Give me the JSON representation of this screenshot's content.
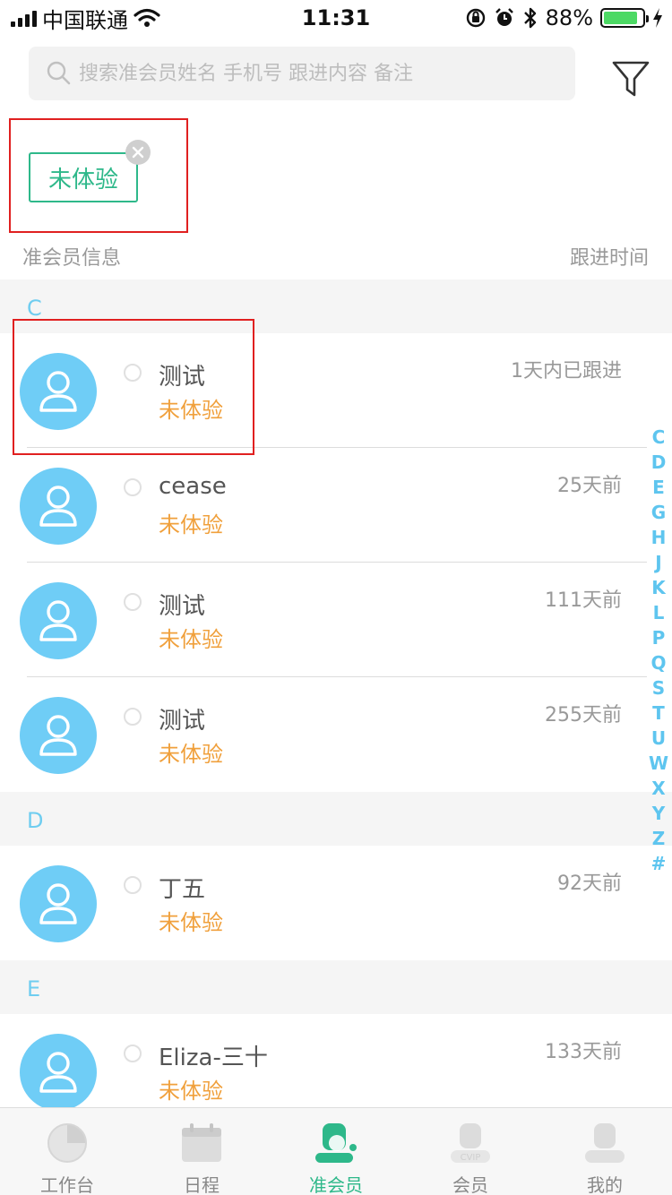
{
  "status_bar": {
    "carrier": "中国联通",
    "time": "11:31",
    "battery_percent": "88%",
    "battery_level": 0.88
  },
  "search": {
    "placeholder": "搜索准会员姓名 手机号 跟进内容 备注"
  },
  "filter_tag": {
    "label": "未体验"
  },
  "list_header": {
    "left": "准会员信息",
    "right": "跟进时间"
  },
  "sections": [
    {
      "letter": "C",
      "rows": [
        {
          "name": "测试",
          "status": "未体验",
          "time": "1天内已跟进"
        },
        {
          "name": "cease",
          "status": "未体验",
          "time": "25天前"
        },
        {
          "name": "测试",
          "status": "未体验",
          "time": "111天前"
        },
        {
          "name": "测试",
          "status": "未体验",
          "time": "255天前"
        }
      ]
    },
    {
      "letter": "D",
      "rows": [
        {
          "name": "丁五",
          "status": "未体验",
          "time": "92天前"
        }
      ]
    },
    {
      "letter": "E",
      "rows": [
        {
          "name": "Eliza-三十",
          "status": "未体验",
          "time": "133天前"
        }
      ]
    }
  ],
  "index_letters": [
    "C",
    "D",
    "E",
    "G",
    "H",
    "J",
    "K",
    "L",
    "P",
    "Q",
    "S",
    "T",
    "U",
    "W",
    "X",
    "Y",
    "Z",
    "#"
  ],
  "tabs": [
    {
      "label": "工作台",
      "icon": "pie-chart-icon"
    },
    {
      "label": "日程",
      "icon": "calendar-icon"
    },
    {
      "label": "准会员",
      "icon": "prospect-member-icon",
      "active": true
    },
    {
      "label": "会员",
      "icon": "vip-member-icon"
    },
    {
      "label": "我的",
      "icon": "person-icon"
    }
  ],
  "colors": {
    "accent": "#2eb88a",
    "status": "#f0a03c",
    "avatar": "#6fcdf6",
    "index": "#5ec5ef",
    "highlight": "#e02020"
  }
}
